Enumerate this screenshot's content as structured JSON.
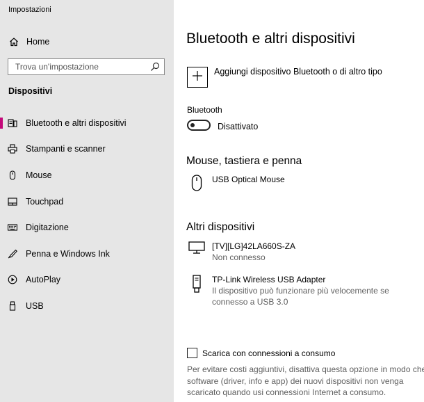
{
  "window": {
    "title": "Impostazioni"
  },
  "sidebar": {
    "home_label": "Home",
    "search_placeholder": "Trova un'impostazione",
    "section_title": "Dispositivi",
    "items": [
      {
        "label": "Bluetooth e altri dispositivi",
        "icon": "bluetooth-devices-icon",
        "active": true
      },
      {
        "label": "Stampanti e scanner",
        "icon": "printer-icon"
      },
      {
        "label": "Mouse",
        "icon": "mouse-icon"
      },
      {
        "label": "Touchpad",
        "icon": "touchpad-icon"
      },
      {
        "label": "Digitazione",
        "icon": "keyboard-icon"
      },
      {
        "label": "Penna e Windows Ink",
        "icon": "pen-icon"
      },
      {
        "label": "AutoPlay",
        "icon": "autoplay-icon"
      },
      {
        "label": "USB",
        "icon": "usb-icon"
      }
    ],
    "active_color": "#c40a7a"
  },
  "main": {
    "title": "Bluetooth e altri dispositivi",
    "add_device_label": "Aggiungi dispositivo Bluetooth o di altro tipo",
    "bluetooth": {
      "label": "Bluetooth",
      "state": "Disattivato",
      "on": false
    },
    "mouse_section": {
      "heading": "Mouse, tastiera e penna",
      "devices": [
        {
          "name": "USB Optical Mouse",
          "icon": "mouse-icon"
        }
      ]
    },
    "other_section": {
      "heading": "Altri dispositivi",
      "devices": [
        {
          "name": "[TV][LG]42LA660S-ZA",
          "status": "Non connesso",
          "icon": "monitor-icon"
        },
        {
          "name": "TP-Link Wireless USB Adapter",
          "status_line1": "Il dispositivo può funzionare più velocemente se",
          "status_line2": "connesso a USB 3.0",
          "icon": "usb-adapter-icon"
        }
      ]
    },
    "metered": {
      "label": "Scarica con connessioni a consumo",
      "checked": false,
      "desc_line1": "Per evitare costi aggiuntivi, disattiva questa opzione in modo che il",
      "desc_line2": "software (driver, info e app) dei nuovi dispositivi non venga",
      "desc_line3": "scaricato quando usi connessioni Internet a consumo."
    }
  }
}
